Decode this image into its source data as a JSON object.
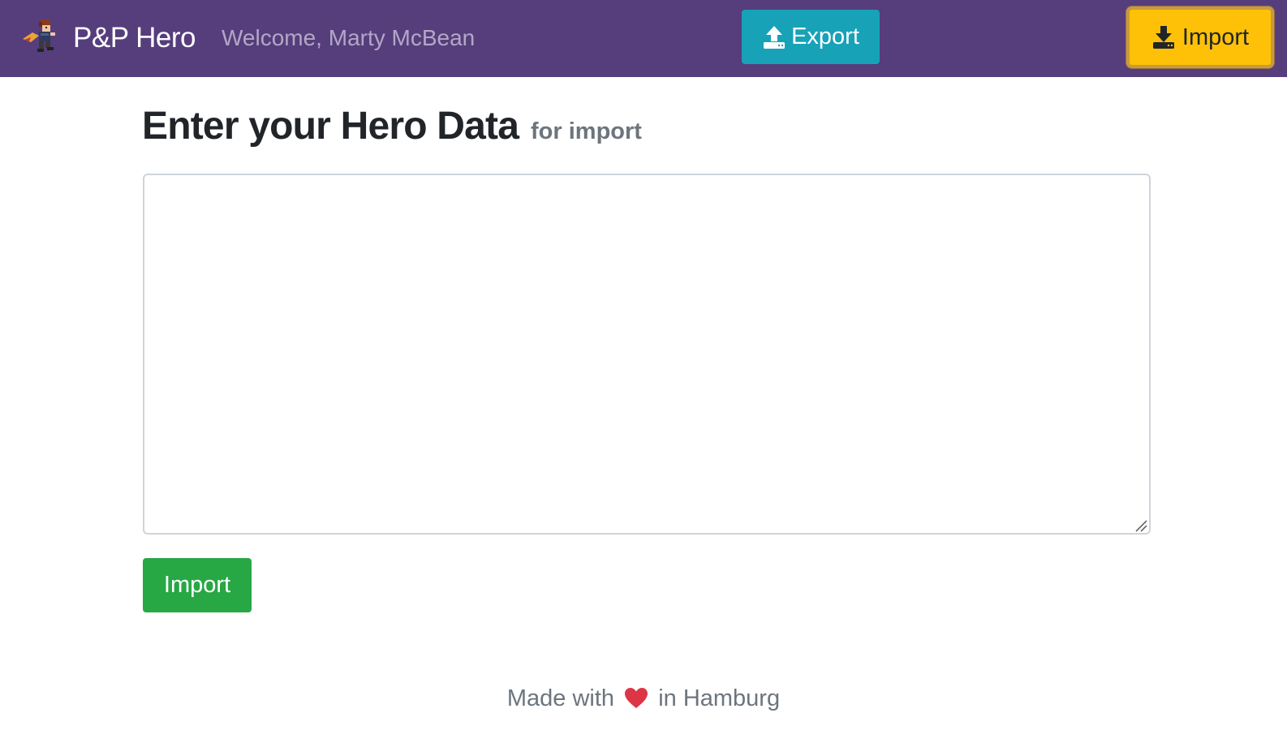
{
  "navbar": {
    "brand": "P&P Hero",
    "welcome": "Welcome, Marty McBean",
    "export_label": "Export",
    "import_label": "Import"
  },
  "main": {
    "title": "Enter your Hero Data",
    "subtitle": "for import",
    "textarea_value": "",
    "import_button_label": "Import"
  },
  "footer": {
    "made_with": "Made with",
    "in_city": "in Hamburg"
  },
  "icons": {
    "logo": "hero-sprite-icon",
    "export": "upload-icon",
    "import": "download-icon",
    "heart": "heart-icon"
  },
  "colors": {
    "navbar": "#563d7c",
    "export_button": "#17a2b8",
    "import_nav_button": "#ffc107",
    "import_main_button": "#28a745",
    "heart": "#dc3545"
  }
}
